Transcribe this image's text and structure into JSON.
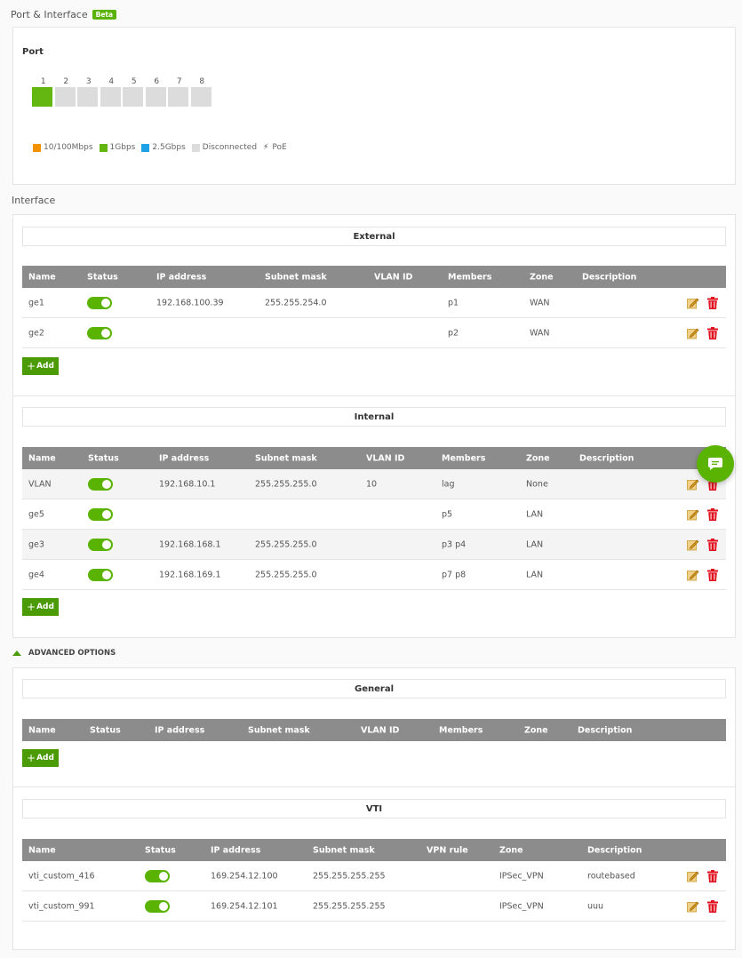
{
  "page": {
    "title": "Port & Interface",
    "badge": "Beta"
  },
  "port": {
    "heading": "Port",
    "ports": [
      {
        "label": "1",
        "status": "1gbps"
      },
      {
        "label": "2",
        "status": "disconnected"
      },
      {
        "label": "3",
        "status": "disconnected"
      },
      {
        "label": "4",
        "status": "disconnected"
      },
      {
        "label": "5",
        "status": "disconnected"
      },
      {
        "label": "6",
        "status": "disconnected"
      },
      {
        "label": "7",
        "status": "disconnected"
      },
      {
        "label": "8",
        "status": "disconnected"
      }
    ],
    "legend": [
      {
        "label": "10/100Mbps",
        "color": "#f39200"
      },
      {
        "label": "1Gbps",
        "color": "#64b711"
      },
      {
        "label": "2.5Gbps",
        "color": "#1ea2e6"
      },
      {
        "label": "Disconnected",
        "color": "#dcdcdc"
      }
    ],
    "poe_label": "PoE"
  },
  "interface": {
    "title": "Interface",
    "add_label": "Add",
    "external": {
      "title": "External",
      "columns": [
        "Name",
        "Status",
        "IP address",
        "Subnet mask",
        "VLAN ID",
        "Members",
        "Zone",
        "Description"
      ],
      "rows": [
        {
          "name": "ge1",
          "ip": "192.168.100.39",
          "mask": "255.255.254.0",
          "vlan": "",
          "members": "p1",
          "zone": "WAN",
          "desc": ""
        },
        {
          "name": "ge2",
          "ip": "",
          "mask": "",
          "vlan": "",
          "members": "p2",
          "zone": "WAN",
          "desc": ""
        }
      ]
    },
    "internal": {
      "title": "Internal",
      "columns": [
        "Name",
        "Status",
        "IP address",
        "Subnet mask",
        "VLAN ID",
        "Members",
        "Zone",
        "Description"
      ],
      "rows": [
        {
          "name": "VLAN",
          "ip": "192.168.10.1",
          "mask": "255.255.255.0",
          "vlan": "10",
          "members": "lag",
          "zone": "None",
          "desc": ""
        },
        {
          "name": "ge5",
          "ip": "",
          "mask": "",
          "vlan": "",
          "members": "p5",
          "zone": "LAN",
          "desc": ""
        },
        {
          "name": "ge3",
          "ip": "192.168.168.1",
          "mask": "255.255.255.0",
          "vlan": "",
          "members": "p3 p4",
          "zone": "LAN",
          "desc": ""
        },
        {
          "name": "ge4",
          "ip": "192.168.169.1",
          "mask": "255.255.255.0",
          "vlan": "",
          "members": "p7 p8",
          "zone": "LAN",
          "desc": ""
        }
      ]
    },
    "advanced": {
      "toggle_label": "ADVANCED OPTIONS",
      "general": {
        "title": "General",
        "columns": [
          "Name",
          "Status",
          "IP address",
          "Subnet mask",
          "VLAN ID",
          "Members",
          "Zone",
          "Description"
        ]
      },
      "vti": {
        "title": "VTI",
        "columns": [
          "Name",
          "Status",
          "IP address",
          "Subnet mask",
          "VPN rule",
          "Zone",
          "Description"
        ],
        "rows": [
          {
            "name": "vti_custom_416",
            "ip": "169.254.12.100",
            "mask": "255.255.255.255",
            "vpn": "",
            "zone": "IPSec_VPN",
            "desc": "routebased"
          },
          {
            "name": "vti_custom_991",
            "ip": "169.254.12.101",
            "mask": "255.255.255.255",
            "vpn": "",
            "zone": "IPSec_VPN",
            "desc": "uuu"
          }
        ]
      }
    }
  }
}
